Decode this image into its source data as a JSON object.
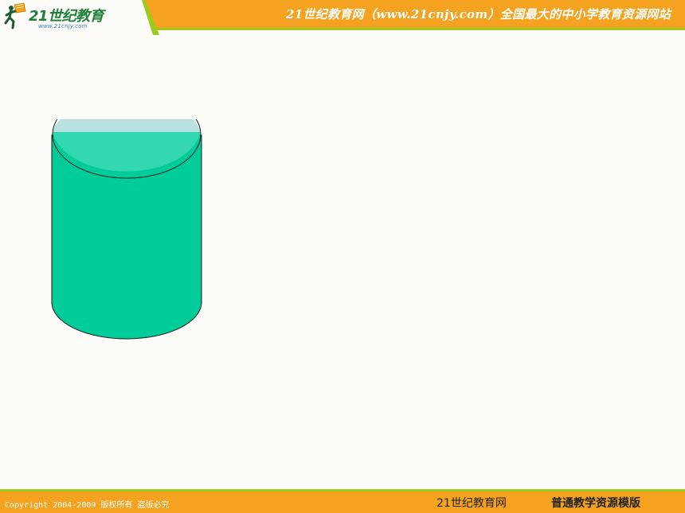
{
  "header": {
    "logo_text": "21世纪教育",
    "logo_url": "www.21cnjy.com",
    "title": "21世纪教育网（www.21cnjy.com）全国最大的中小学教育资源网站"
  },
  "figure": {
    "shape": "cylinder",
    "colors": {
      "body": "#00CC99",
      "top_upper": "#B9E0E1",
      "top_lower": "#33D8B0",
      "outline": "#1A1A1A"
    }
  },
  "footer": {
    "copyright": "Copyright 2004-2009 版权所有 盗版必究",
    "site": "21世纪教育网",
    "template": "普通教学资源模版"
  },
  "colors": {
    "header_bg": "#F4A21F",
    "accent_green": "#9BCB1C",
    "page_bg": "#FDFCF9"
  }
}
